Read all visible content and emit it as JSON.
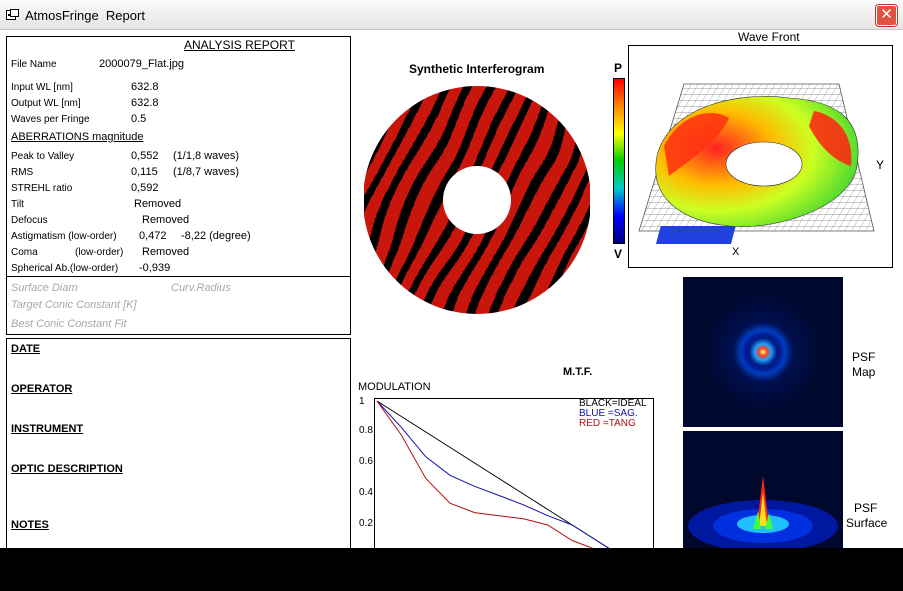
{
  "window": {
    "title": "AtmosFringe  Report",
    "close": "✕"
  },
  "report": {
    "header": "ANALYSIS  REPORT",
    "file_name_label": "File Name",
    "file_name": "2000079_Flat.jpg",
    "input_wl_label": "Input  WL [nm]",
    "input_wl": "632.8",
    "output_wl_label": "Output WL [nm]",
    "output_wl": "632.8",
    "waves_label": "Waves per Fringe",
    "waves": "0.5",
    "aberrations_header": "ABERRATIONS magnitude",
    "ptv_label": "Peak to Valley",
    "ptv": "0,552",
    "ptv_waves": "(1/1,8 waves)",
    "rms_label": "RMS",
    "rms": "0,115",
    "rms_waves": "(1/8,7 waves)",
    "strehl_label": "STREHL ratio",
    "strehl": "0,592",
    "tilt_label": "Tilt",
    "tilt": "Removed",
    "defocus_label": "Defocus",
    "defocus": "Removed",
    "astig_label": "Astigmatism  (low-order)",
    "astig": "0,472",
    "astig_deg": "-8,22  (degree)",
    "coma_label": "Coma",
    "coma_order": "(low-order)",
    "coma": "Removed",
    "spherical_label": "Spherical Ab.(low-order)",
    "spherical": "-0,939"
  },
  "surface": {
    "diam": "Surface Diam",
    "curv": "Curv.Radius",
    "target_conic": "Target Conic Constant [K]",
    "best_conic": "Best Conic Constant Fit"
  },
  "meta": {
    "date": "DATE",
    "operator": "OPERATOR",
    "instrument": "INSTRUMENT",
    "optic": "OPTIC DESCRIPTION",
    "notes": "NOTES"
  },
  "interferogram": {
    "title": "Synthetic Interferogram",
    "scale_top": "P",
    "scale_bottom": "V"
  },
  "wavefront": {
    "title": "Wave Front",
    "axis_y": "Y",
    "axis_x": "X"
  },
  "psf": {
    "map_label_1": "PSF",
    "map_label_2": "Map",
    "surface_label_1": "PSF",
    "surface_label_2": "Surface"
  },
  "colors": {
    "fringe": "#cc1410",
    "ideal": "#000000",
    "sag": "#1010b0",
    "tang": "#b01010"
  },
  "chart_data": {
    "type": "line",
    "title": "M.T.F.",
    "ylabel": "MODULATION",
    "xlabel": "",
    "ylim": [
      0,
      1
    ],
    "yticks": [
      "1",
      "0.8",
      "0.6",
      "0.4",
      "0.2"
    ],
    "legend": [
      "BLACK=IDEAL",
      "BLUE  =SAG.",
      "RED    =TANG"
    ],
    "legend_position": "top-right",
    "x": [
      0,
      0.1,
      0.2,
      0.3,
      0.4,
      0.5,
      0.6,
      0.7,
      0.8,
      0.9,
      1.0
    ],
    "series": [
      {
        "name": "IDEAL",
        "values": [
          1.0,
          0.9,
          0.8,
          0.7,
          0.6,
          0.5,
          0.4,
          0.3,
          0.2,
          0.1,
          0.0
        ]
      },
      {
        "name": "SAG.",
        "values": [
          1.0,
          0.83,
          0.64,
          0.52,
          0.45,
          0.39,
          0.33,
          0.26,
          0.2,
          0.1,
          0.0
        ]
      },
      {
        "name": "TANG",
        "values": [
          1.0,
          0.78,
          0.5,
          0.34,
          0.28,
          0.26,
          0.24,
          0.2,
          0.1,
          0.04,
          0.0
        ]
      }
    ]
  }
}
